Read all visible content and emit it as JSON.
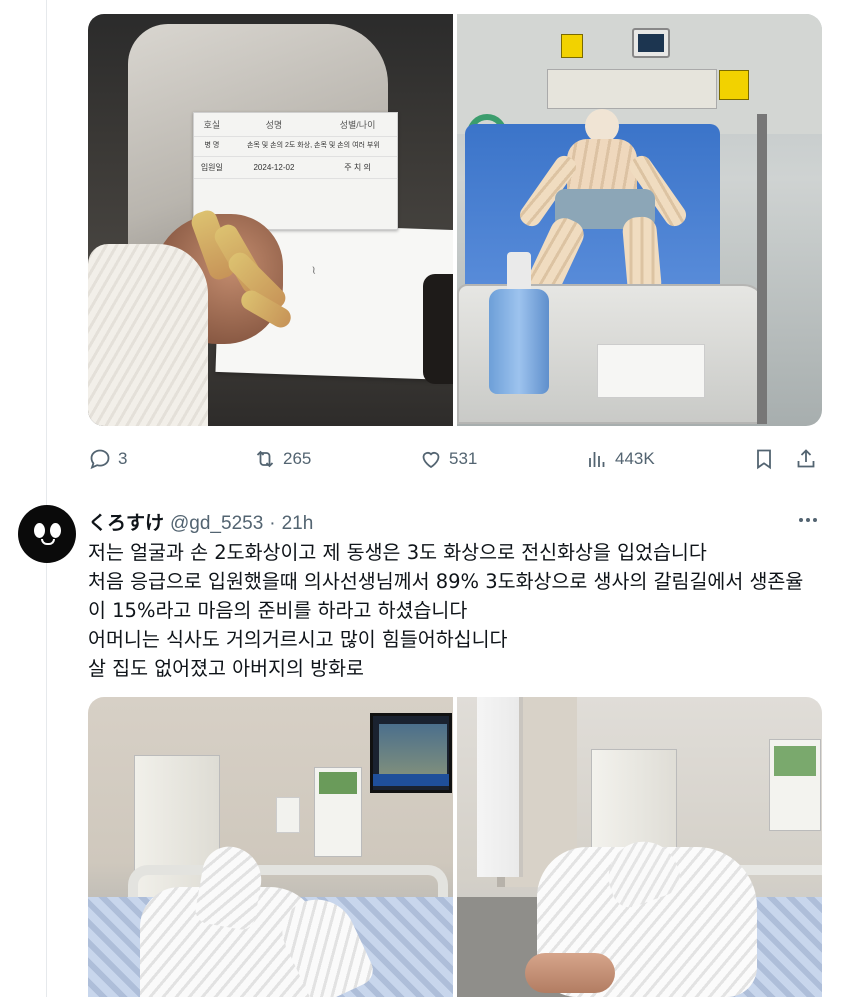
{
  "top_media": {
    "photo1": {
      "form_headers": [
        "호실",
        "성명",
        "성별/나이"
      ],
      "form_row2_label": "병 명",
      "form_row2_value": "손목 및 손의 2도 화상, 손목 및 손의 여러 부위",
      "form_row3_label": "입원일",
      "form_row3_value": "2024-12-02",
      "form_row3_extra": "주 치 의"
    }
  },
  "actions": {
    "reply_count": "3",
    "retweet_count": "265",
    "like_count": "531",
    "view_count": "443K",
    "icons": [
      "reply-icon",
      "retweet-icon",
      "like-icon",
      "views-icon",
      "bookmark-icon",
      "share-icon"
    ]
  },
  "tweet": {
    "display_name": "くろすけ",
    "handle": "@gd_5253",
    "separator": "·",
    "time": "21h",
    "lines": [
      "저는 얼굴과 손 2도화상이고 제 동생은 3도 화상으로 전신화상을 입었습니다",
      "처음 응급으로 입원했을때 의사선생님께서 89% 3도화상으로 생사의 갈림길에서 생존율",
      "이 15%라고 마음의 준비를 하라고 하셨습니다",
      "어머니는 식사도 거의거르시고 많이 힘들어하십니다",
      "살 집도 없어졌고 아버지의 방화로"
    ]
  },
  "colors": {
    "text_primary": "#0f1419",
    "text_secondary": "#536471",
    "divider": "#e6e9ec"
  }
}
